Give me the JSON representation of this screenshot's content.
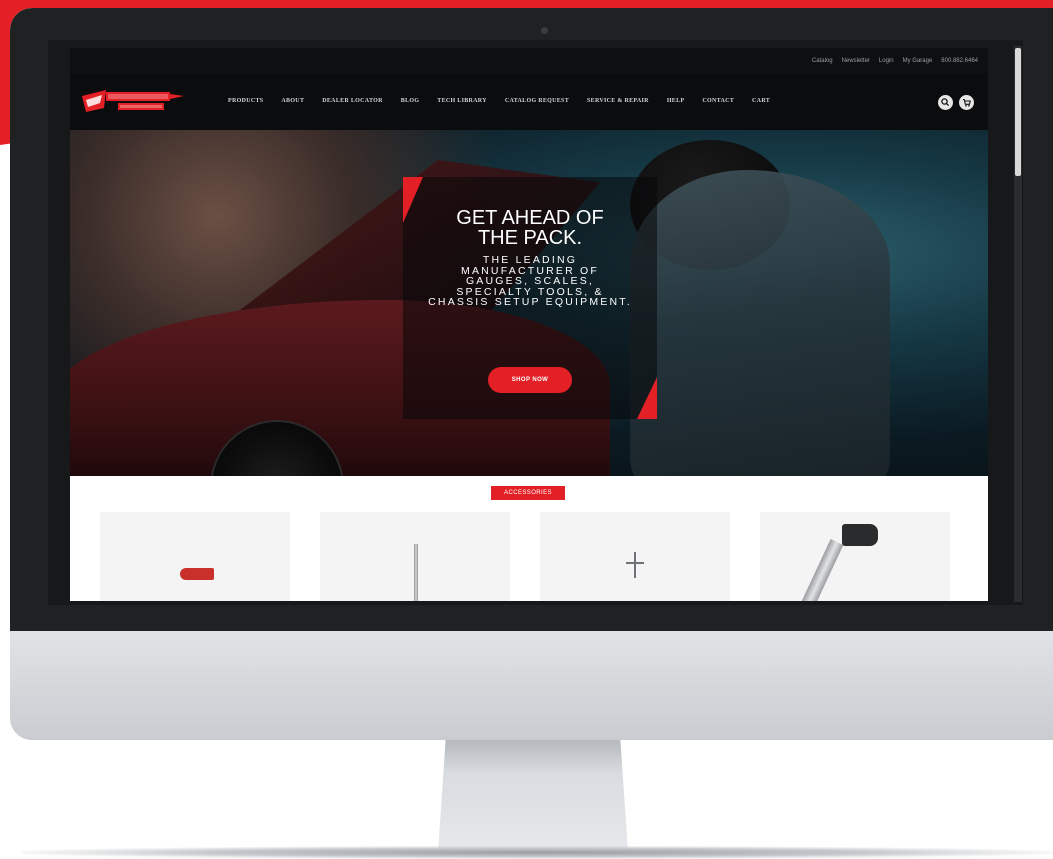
{
  "utility_nav": {
    "items": [
      "Catalog",
      "Newsletter",
      "Login",
      "My Garage",
      "800.882.6464"
    ]
  },
  "main_nav": {
    "logo_alt": "Longacre Racing Products",
    "items": [
      "PRODUCTS",
      "ABOUT",
      "DEALER LOCATOR",
      "BLOG",
      "TECH LIBRARY",
      "CATALOG REQUEST",
      "SERVICE & REPAIR",
      "HELP",
      "CONTACT",
      "CART"
    ],
    "icons": [
      "search-icon",
      "cart-icon"
    ]
  },
  "hero": {
    "headline": "GET AHEAD OF\nTHE PACK.",
    "subhead": "THE LEADING\nMANUFACTURER OF\nGAUGES, SCALES,\nSPECIALTY TOOLS, &\nCHASSIS SETUP EQUIPMENT.",
    "cta": "SHOP NOW"
  },
  "accessories": {
    "badge": "ACCESSORIES"
  },
  "colors": {
    "brand_red": "#e42027",
    "nav_bg": "#0b0c0d",
    "monitor_bezel": "#1f2123"
  }
}
